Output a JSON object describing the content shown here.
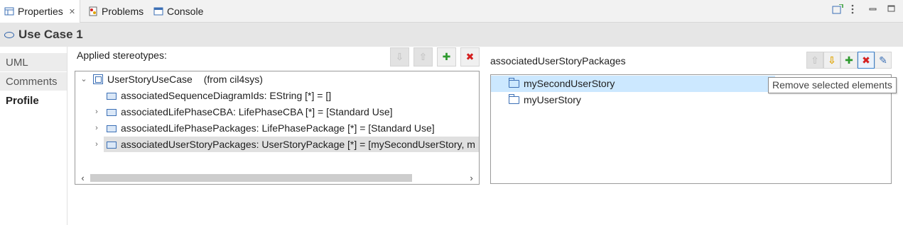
{
  "tabs": [
    {
      "label": "Properties",
      "icon": "properties-icon",
      "active": true,
      "close": "✕"
    },
    {
      "label": "Problems",
      "icon": "problems-icon"
    },
    {
      "label": "Console",
      "icon": "console-icon"
    }
  ],
  "header": {
    "title": "Use Case 1",
    "icon": "use-case-icon"
  },
  "sidebar": {
    "items": [
      "UML",
      "Comments",
      "Profile"
    ],
    "active": "Profile"
  },
  "stereotypes": {
    "label": "Applied stereotypes:",
    "root": {
      "name": "UserStoryUseCase",
      "from": "(from cil4sys)"
    },
    "properties": [
      "associatedSequenceDiagramIds: EString [*] = []",
      "associatedLifePhaseCBA: LifePhaseCBA [*] = [Standard Use]",
      "associatedLifePhasePackages: LifePhasePackage [*] = [Standard Use]",
      "associatedUserStoryPackages: UserStoryPackage [*] = [mySecondUserStory, m"
    ],
    "selected_index": 3
  },
  "assoc": {
    "label": "associatedUserStoryPackages",
    "items": [
      "mySecondUserStory",
      "myUserStory"
    ],
    "selected_index": 0,
    "tooltip": "Remove selected elements"
  },
  "colors": {
    "accent": "#3c82cc",
    "selection": "#cce8ff",
    "add": "#2e9a2e",
    "remove": "#d42020"
  }
}
